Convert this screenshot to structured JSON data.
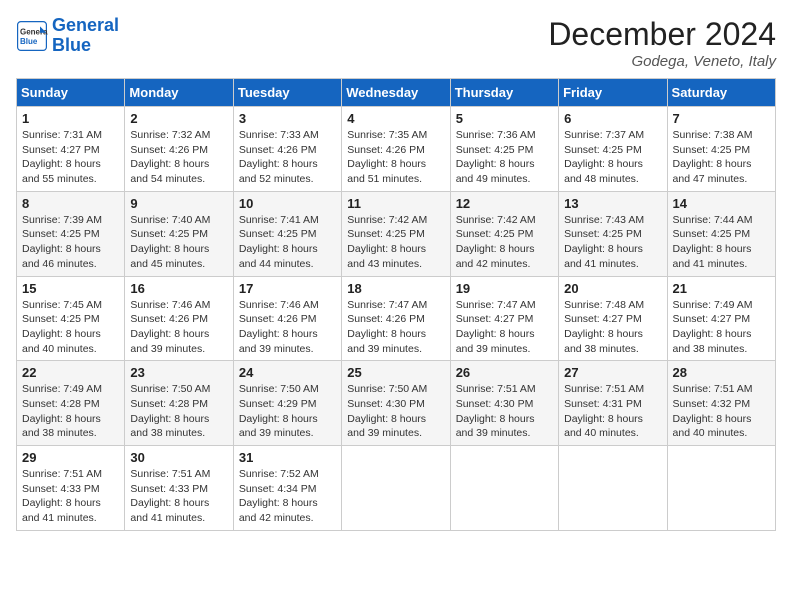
{
  "logo": {
    "line1": "General",
    "line2": "Blue"
  },
  "title": "December 2024",
  "location": "Godega, Veneto, Italy",
  "weekdays": [
    "Sunday",
    "Monday",
    "Tuesday",
    "Wednesday",
    "Thursday",
    "Friday",
    "Saturday"
  ],
  "weeks": [
    [
      {
        "day": "1",
        "sunrise": "7:31 AM",
        "sunset": "4:27 PM",
        "daylight": "8 hours and 55 minutes."
      },
      {
        "day": "2",
        "sunrise": "7:32 AM",
        "sunset": "4:26 PM",
        "daylight": "8 hours and 54 minutes."
      },
      {
        "day": "3",
        "sunrise": "7:33 AM",
        "sunset": "4:26 PM",
        "daylight": "8 hours and 52 minutes."
      },
      {
        "day": "4",
        "sunrise": "7:35 AM",
        "sunset": "4:26 PM",
        "daylight": "8 hours and 51 minutes."
      },
      {
        "day": "5",
        "sunrise": "7:36 AM",
        "sunset": "4:25 PM",
        "daylight": "8 hours and 49 minutes."
      },
      {
        "day": "6",
        "sunrise": "7:37 AM",
        "sunset": "4:25 PM",
        "daylight": "8 hours and 48 minutes."
      },
      {
        "day": "7",
        "sunrise": "7:38 AM",
        "sunset": "4:25 PM",
        "daylight": "8 hours and 47 minutes."
      }
    ],
    [
      {
        "day": "8",
        "sunrise": "7:39 AM",
        "sunset": "4:25 PM",
        "daylight": "8 hours and 46 minutes."
      },
      {
        "day": "9",
        "sunrise": "7:40 AM",
        "sunset": "4:25 PM",
        "daylight": "8 hours and 45 minutes."
      },
      {
        "day": "10",
        "sunrise": "7:41 AM",
        "sunset": "4:25 PM",
        "daylight": "8 hours and 44 minutes."
      },
      {
        "day": "11",
        "sunrise": "7:42 AM",
        "sunset": "4:25 PM",
        "daylight": "8 hours and 43 minutes."
      },
      {
        "day": "12",
        "sunrise": "7:42 AM",
        "sunset": "4:25 PM",
        "daylight": "8 hours and 42 minutes."
      },
      {
        "day": "13",
        "sunrise": "7:43 AM",
        "sunset": "4:25 PM",
        "daylight": "8 hours and 41 minutes."
      },
      {
        "day": "14",
        "sunrise": "7:44 AM",
        "sunset": "4:25 PM",
        "daylight": "8 hours and 41 minutes."
      }
    ],
    [
      {
        "day": "15",
        "sunrise": "7:45 AM",
        "sunset": "4:25 PM",
        "daylight": "8 hours and 40 minutes."
      },
      {
        "day": "16",
        "sunrise": "7:46 AM",
        "sunset": "4:26 PM",
        "daylight": "8 hours and 39 minutes."
      },
      {
        "day": "17",
        "sunrise": "7:46 AM",
        "sunset": "4:26 PM",
        "daylight": "8 hours and 39 minutes."
      },
      {
        "day": "18",
        "sunrise": "7:47 AM",
        "sunset": "4:26 PM",
        "daylight": "8 hours and 39 minutes."
      },
      {
        "day": "19",
        "sunrise": "7:47 AM",
        "sunset": "4:27 PM",
        "daylight": "8 hours and 39 minutes."
      },
      {
        "day": "20",
        "sunrise": "7:48 AM",
        "sunset": "4:27 PM",
        "daylight": "8 hours and 38 minutes."
      },
      {
        "day": "21",
        "sunrise": "7:49 AM",
        "sunset": "4:27 PM",
        "daylight": "8 hours and 38 minutes."
      }
    ],
    [
      {
        "day": "22",
        "sunrise": "7:49 AM",
        "sunset": "4:28 PM",
        "daylight": "8 hours and 38 minutes."
      },
      {
        "day": "23",
        "sunrise": "7:50 AM",
        "sunset": "4:28 PM",
        "daylight": "8 hours and 38 minutes."
      },
      {
        "day": "24",
        "sunrise": "7:50 AM",
        "sunset": "4:29 PM",
        "daylight": "8 hours and 39 minutes."
      },
      {
        "day": "25",
        "sunrise": "7:50 AM",
        "sunset": "4:30 PM",
        "daylight": "8 hours and 39 minutes."
      },
      {
        "day": "26",
        "sunrise": "7:51 AM",
        "sunset": "4:30 PM",
        "daylight": "8 hours and 39 minutes."
      },
      {
        "day": "27",
        "sunrise": "7:51 AM",
        "sunset": "4:31 PM",
        "daylight": "8 hours and 40 minutes."
      },
      {
        "day": "28",
        "sunrise": "7:51 AM",
        "sunset": "4:32 PM",
        "daylight": "8 hours and 40 minutes."
      }
    ],
    [
      {
        "day": "29",
        "sunrise": "7:51 AM",
        "sunset": "4:33 PM",
        "daylight": "8 hours and 41 minutes."
      },
      {
        "day": "30",
        "sunrise": "7:51 AM",
        "sunset": "4:33 PM",
        "daylight": "8 hours and 41 minutes."
      },
      {
        "day": "31",
        "sunrise": "7:52 AM",
        "sunset": "4:34 PM",
        "daylight": "8 hours and 42 minutes."
      },
      null,
      null,
      null,
      null
    ]
  ],
  "labels": {
    "sunrise": "Sunrise:",
    "sunset": "Sunset:",
    "daylight": "Daylight:"
  }
}
